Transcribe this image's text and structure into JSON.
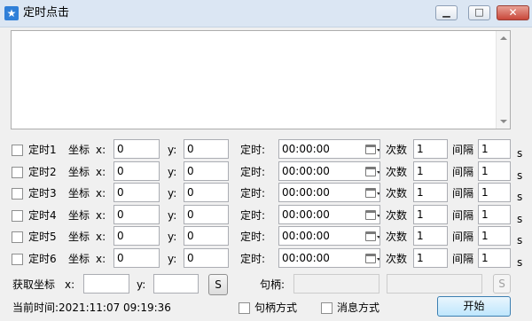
{
  "window": {
    "title": "定时点击",
    "icon": "star-icon",
    "controls": {
      "minimize": "▁",
      "maximize": "□",
      "close": "✕"
    }
  },
  "log": {
    "text": ""
  },
  "labels": {
    "coord": "坐标",
    "x": "x:",
    "y": "y:",
    "timer": "定时:",
    "count": "次数",
    "interval": "间隔",
    "unit_s": "s"
  },
  "timers": [
    {
      "name": "定时1",
      "checked": false,
      "x": "0",
      "y": "0",
      "time": "00:00:00",
      "count": "1",
      "interval": "1"
    },
    {
      "name": "定时2",
      "checked": false,
      "x": "0",
      "y": "0",
      "time": "00:00:00",
      "count": "1",
      "interval": "1"
    },
    {
      "name": "定时3",
      "checked": false,
      "x": "0",
      "y": "0",
      "time": "00:00:00",
      "count": "1",
      "interval": "1"
    },
    {
      "name": "定时4",
      "checked": false,
      "x": "0",
      "y": "0",
      "time": "00:00:00",
      "count": "1",
      "interval": "1"
    },
    {
      "name": "定时5",
      "checked": false,
      "x": "0",
      "y": "0",
      "time": "00:00:00",
      "count": "1",
      "interval": "1"
    },
    {
      "name": "定时6",
      "checked": false,
      "x": "0",
      "y": "0",
      "time": "00:00:00",
      "count": "1",
      "interval": "1"
    }
  ],
  "capture": {
    "label": "获取坐标",
    "x_label": "x:",
    "x_value": "",
    "y_label": "y:",
    "y_value": "",
    "button": "S",
    "handle_label": "句柄:",
    "handle_value": "",
    "handle_extra": "",
    "handle_button": "S"
  },
  "footer": {
    "current_time": "当前时间:2021:11:07 09:19:36",
    "handle_mode": "句柄方式",
    "message_mode": "消息方式",
    "start": "开始"
  }
}
